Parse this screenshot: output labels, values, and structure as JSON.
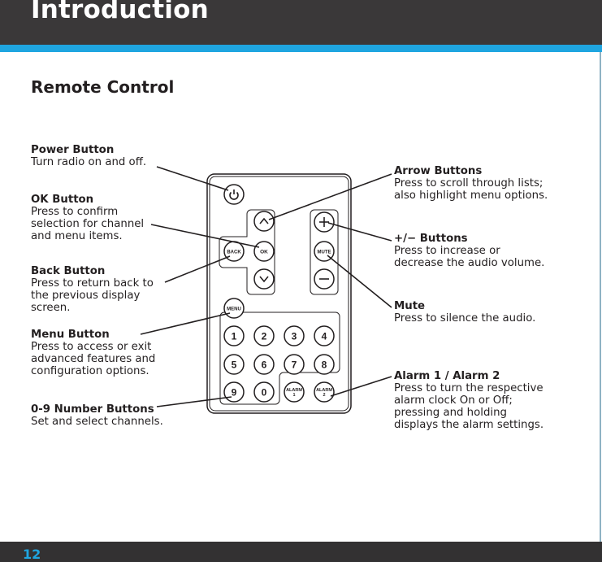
{
  "header": {
    "title": "Introduction"
  },
  "section": {
    "title": "Remote Control"
  },
  "footer": {
    "page_number": "12"
  },
  "colors": {
    "header_bg": "#3a3839",
    "accent_blue": "#1fa5e0",
    "footer_bg": "#333132"
  },
  "callouts": {
    "power": {
      "title": "Power Button",
      "desc": "Turn radio on and off."
    },
    "ok": {
      "title": "OK Button",
      "desc": "Press to confirm\nselection for channel\nand menu items."
    },
    "back": {
      "title": "Back Button",
      "desc": "Press to return back to\nthe previous display\nscreen."
    },
    "menu": {
      "title": "Menu Button",
      "desc": "Press to access or exit\nadvanced features and\nconfiguration options."
    },
    "numbers": {
      "title": "0-9 Number Buttons",
      "desc": "Set and select channels."
    },
    "arrows": {
      "title": "Arrow Buttons",
      "desc": "Press to scroll through lists;\nalso highlight menu options."
    },
    "volume": {
      "title": "+/− Buttons",
      "desc": "Press to increase or\ndecrease the audio volume."
    },
    "mute": {
      "title": "Mute",
      "desc": "Press to silence the audio."
    },
    "alarm": {
      "title": "Alarm 1 / Alarm 2",
      "desc": "Press to turn the respective\nalarm clock On or Off;\npressing and holding\ndisplays the alarm settings."
    }
  },
  "remote": {
    "icons": {
      "power": "power-icon",
      "up": "chevron-up-icon",
      "down": "chevron-down-icon",
      "plus": "plus-icon",
      "minus": "minus-icon"
    },
    "labels": {
      "back": "BACK",
      "ok": "OK",
      "mute": "MUTE",
      "menu": "MENU",
      "alarm": "ALARM",
      "alarm1_num": "1",
      "alarm2_num": "2"
    },
    "number_keys": [
      "1",
      "2",
      "3",
      "4",
      "5",
      "6",
      "7",
      "8",
      "9",
      "0"
    ]
  }
}
